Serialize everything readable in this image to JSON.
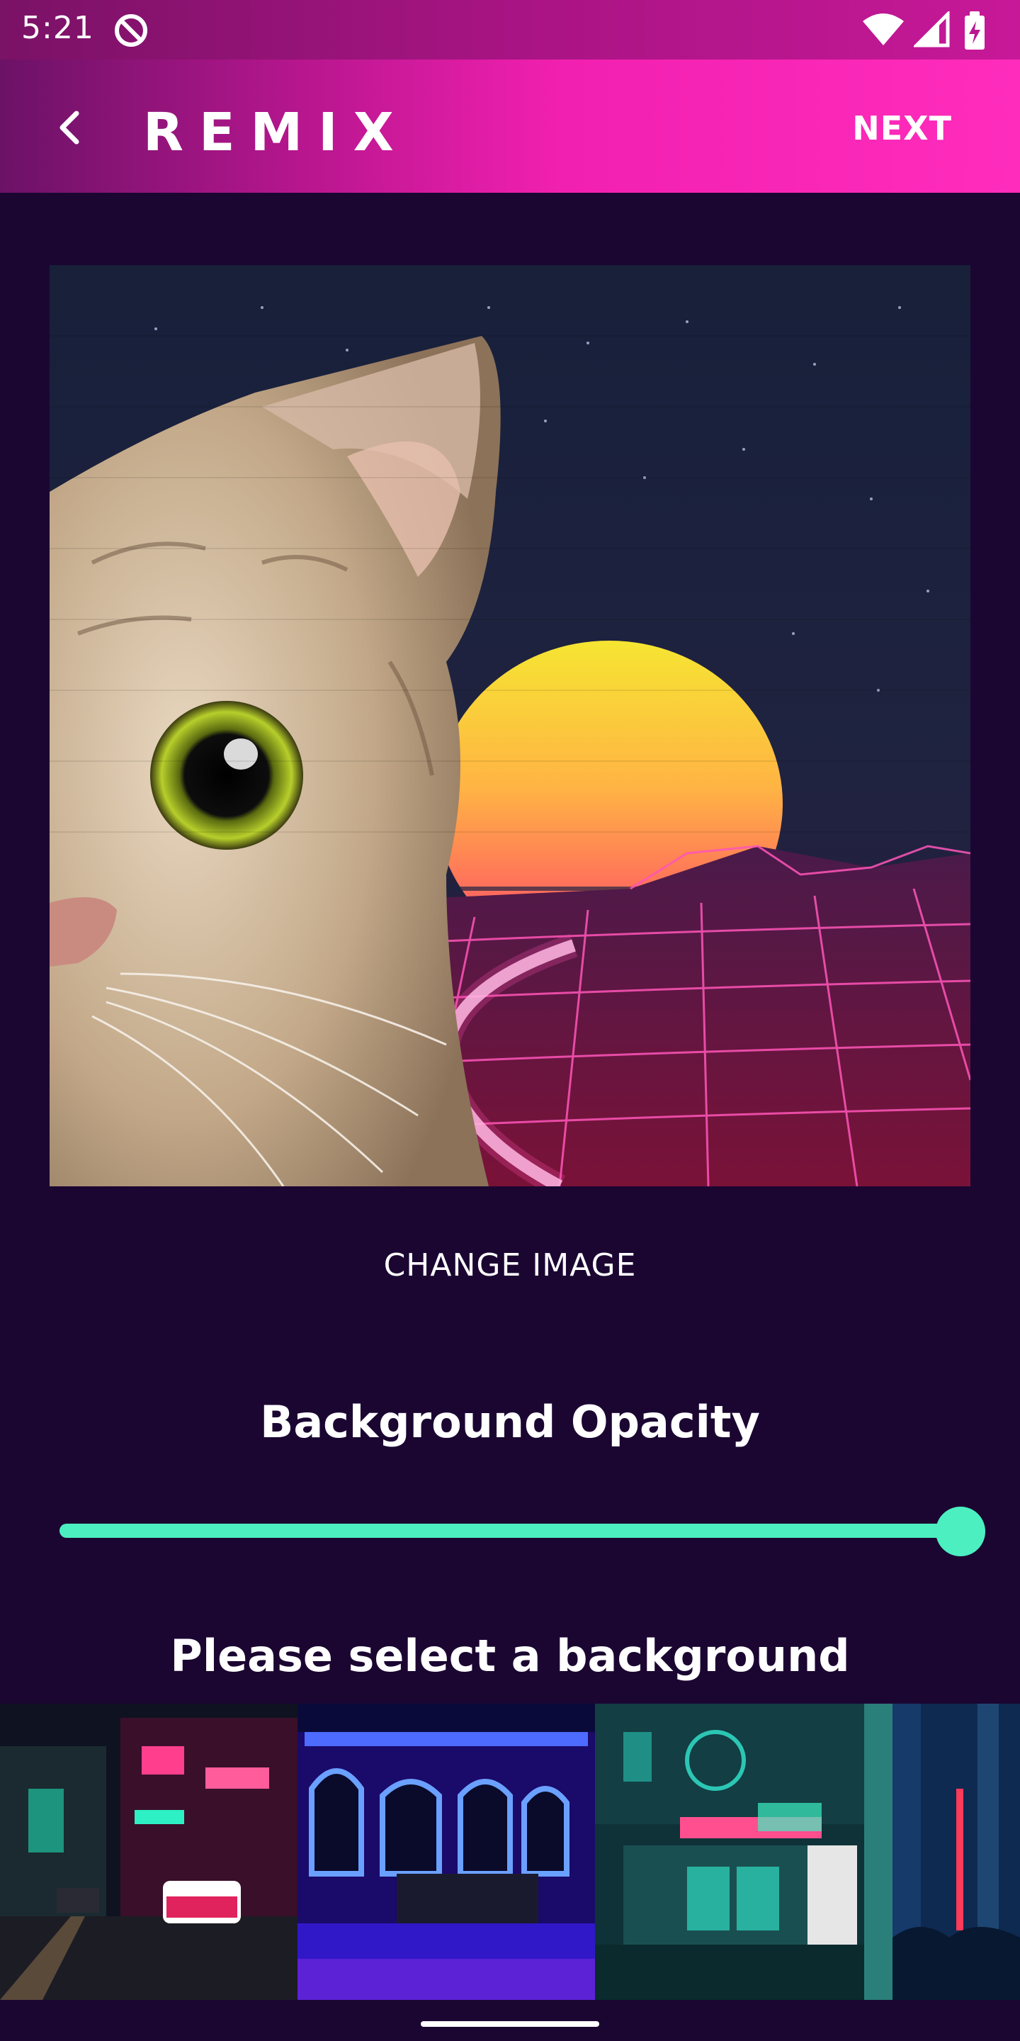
{
  "status_bar": {
    "time": "5:21",
    "icons": [
      "at-sign-icon",
      "wifi-icon",
      "cell-signal-icon",
      "battery-charging-icon"
    ]
  },
  "app_bar": {
    "back_icon": "back-arrow-icon",
    "logo_text": "REMIX",
    "next_label": "NEXT"
  },
  "preview": {
    "description_icon": "cat-synthwave-image"
  },
  "change_image_label": "CHANGE IMAGE",
  "opacity": {
    "title": "Background Opacity",
    "value_percent": 100
  },
  "backgrounds": {
    "title": "Please select a background",
    "items": [
      {
        "name": "neon-street-night"
      },
      {
        "name": "blue-neon-building"
      },
      {
        "name": "teal-neon-storefront"
      },
      {
        "name": "blue-red-alley"
      }
    ]
  },
  "colors": {
    "accent": "#4cf0c0",
    "background": "#1b0632",
    "appbar_pink": "#ff2cbc"
  }
}
